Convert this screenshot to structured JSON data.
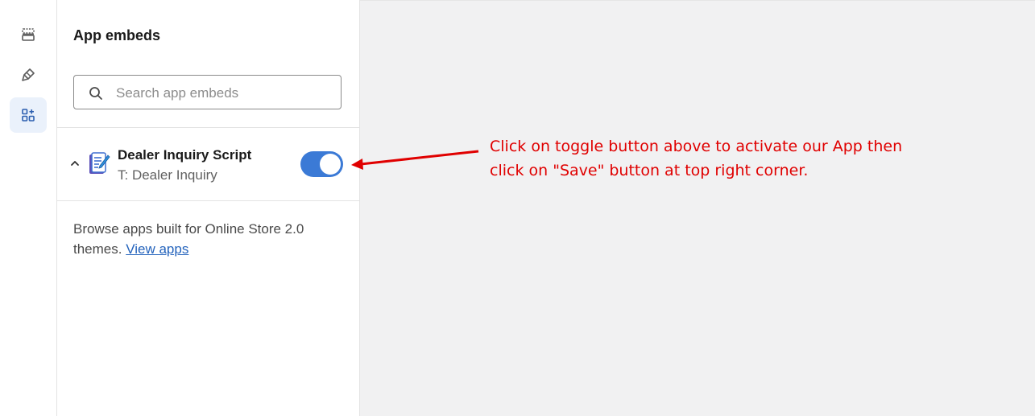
{
  "rail": {
    "items": [
      {
        "icon": "sections-icon"
      },
      {
        "icon": "theme-settings-brush-icon"
      },
      {
        "icon": "app-embeds-icon",
        "active": true
      }
    ]
  },
  "panel": {
    "title": "App embeds",
    "search": {
      "placeholder": "Search app embeds",
      "value": ""
    },
    "embed": {
      "name": "Dealer Inquiry Script",
      "subtitle": "T: Dealer Inquiry",
      "enabled": true,
      "icon": "app-document-pen-icon",
      "expand_icon": "chevron-up-icon"
    },
    "browse": {
      "text": "Browse apps built for Online Store 2.0 themes.",
      "link": "View apps"
    }
  },
  "annotation": {
    "line1": "Click on toggle button above to activate our App then",
    "line2": "click on \"Save\" button at top right corner.",
    "color": "#e00000"
  },
  "colors": {
    "toggle_on": "#3b7ad6",
    "link": "#2463bc",
    "active_rail_bg": "#eaf1fb"
  }
}
